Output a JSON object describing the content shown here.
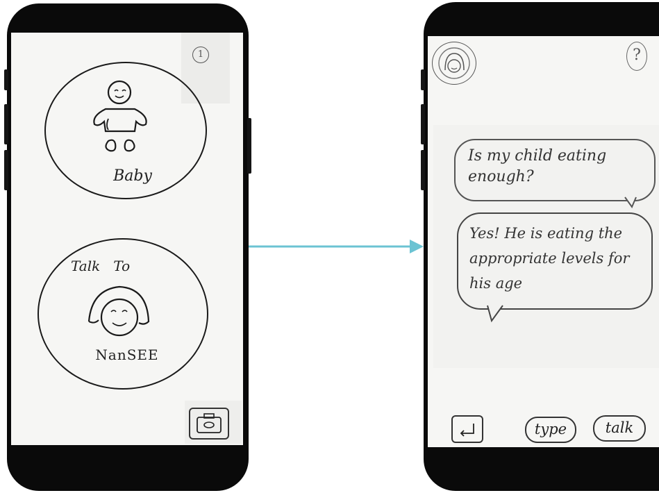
{
  "left_screen": {
    "page_number": "1",
    "baby_label": "Baby",
    "talk_to_label": "Talk   To",
    "nansee_label": "NanSEE",
    "camera_icon": "camera-icon"
  },
  "right_screen": {
    "help_icon_text": "?",
    "question_text": "Is my child eating enough?",
    "answer_text": "Yes! He is eating the appropriate levels for his age",
    "type_label": "type",
    "talk_label": "talk",
    "back_icon": "return-arrow-icon"
  },
  "connector": {
    "color": "#6bc3d3"
  }
}
